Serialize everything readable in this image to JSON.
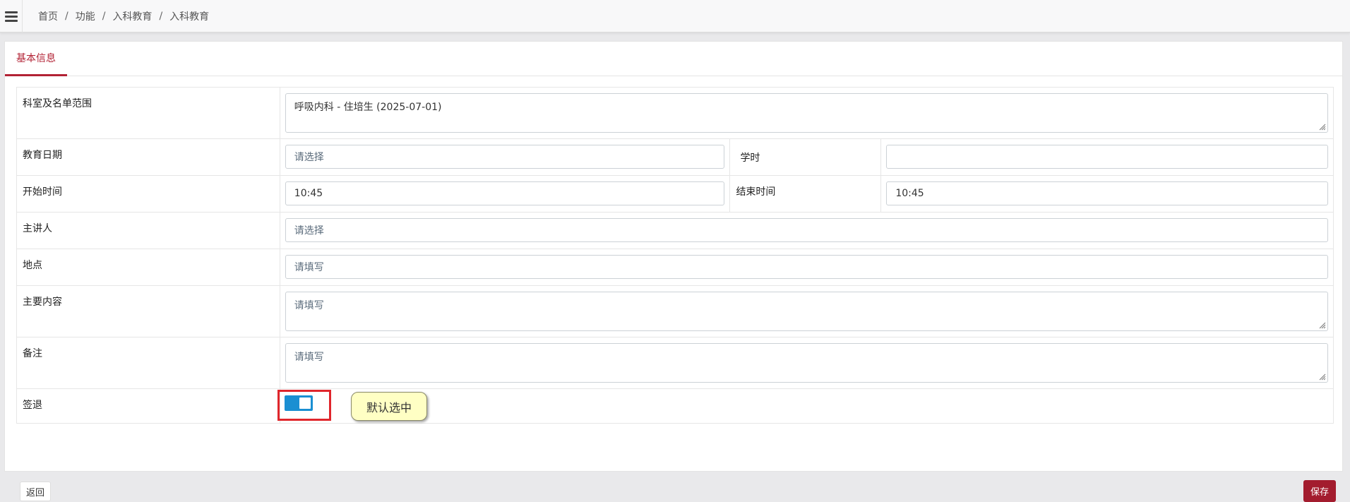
{
  "header": {
    "menu_icon": "hamburger-menu-icon",
    "breadcrumb": [
      "首页",
      "功能",
      "入科教育",
      "入科教育"
    ],
    "separator": "/"
  },
  "tabs": [
    {
      "label": "基本信息",
      "active": true
    }
  ],
  "form": {
    "dept": {
      "label": "科室及名单范围",
      "value": "呼吸内科 - 住培生 (2025-07-01)"
    },
    "edu_date": {
      "label": "教育日期",
      "placeholder": "请选择",
      "value": ""
    },
    "hours": {
      "label": "学时",
      "value": ""
    },
    "start_time": {
      "label": "开始时间",
      "value": "10:45"
    },
    "end_time": {
      "label": "结束时间",
      "value": "10:45"
    },
    "speaker": {
      "label": "主讲人",
      "placeholder": "请选择",
      "value": ""
    },
    "location": {
      "label": "地点",
      "placeholder": "请填写",
      "value": ""
    },
    "content": {
      "label": "主要内容",
      "placeholder": "请填写",
      "value": ""
    },
    "remark": {
      "label": "备注",
      "placeholder": "请填写",
      "value": ""
    },
    "signout": {
      "label": "签退",
      "checked": true
    }
  },
  "annotation": {
    "tooltip": "默认选中"
  },
  "actions": {
    "back_label": "返回",
    "save_label": "保存"
  },
  "colors": {
    "accent": "#b22234",
    "save": "#a31c2e",
    "switch": "#1a8fd2",
    "highlight": "#e0262c",
    "tooltip_bg": "#ffffc4"
  }
}
